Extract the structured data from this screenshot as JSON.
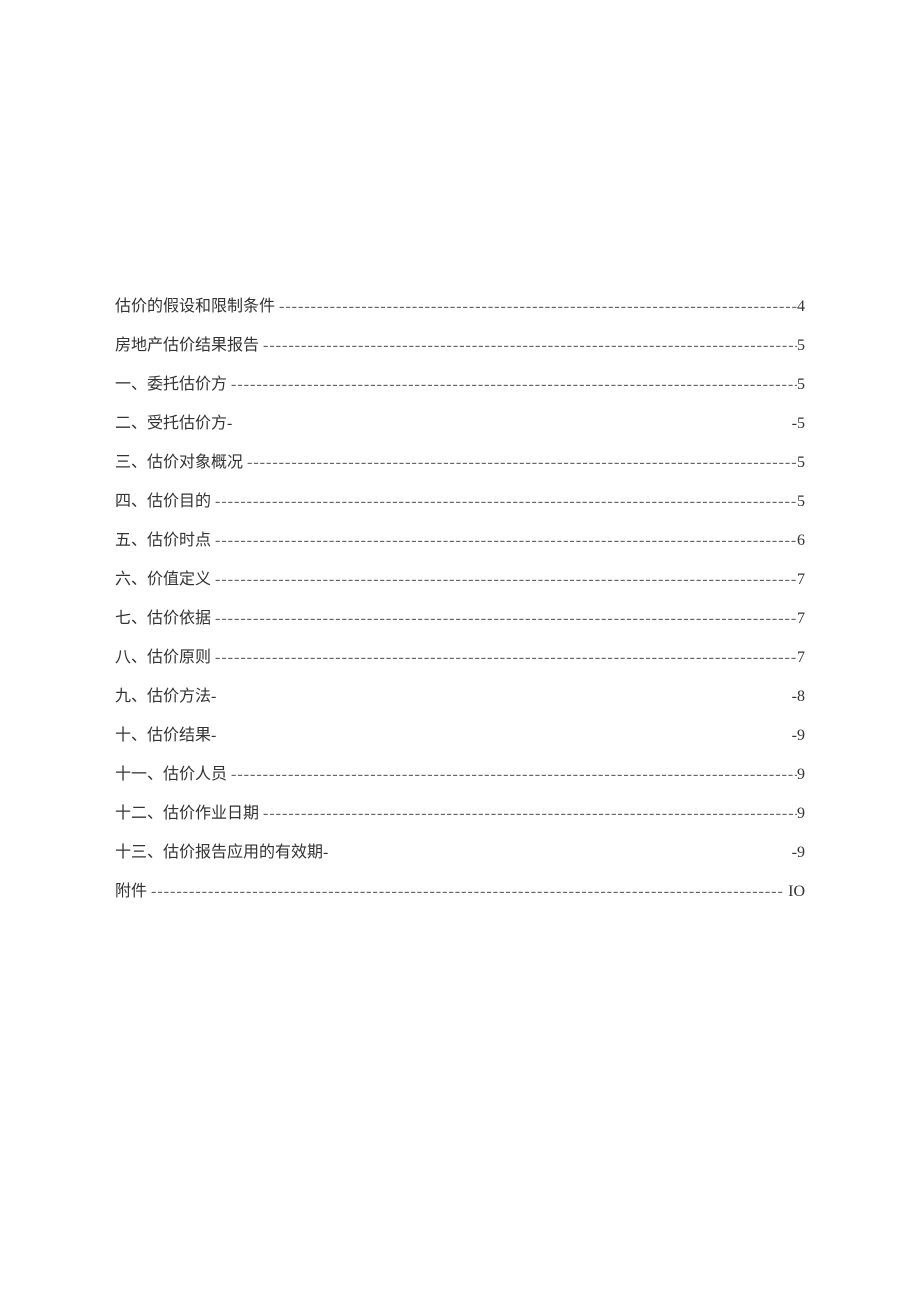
{
  "toc": {
    "entries": [
      {
        "title": "估价的假设和限制条件",
        "page": "4",
        "leader": "dashes",
        "pagePrefix": ""
      },
      {
        "title": "房地产估价结果报告",
        "page": "5",
        "leader": "dashes",
        "pagePrefix": ""
      },
      {
        "title": "一、委托估价方",
        "page": "5",
        "leader": "dashes",
        "pagePrefix": ""
      },
      {
        "title": "二、受托估价方-",
        "page": "5",
        "leader": "blank",
        "pagePrefix": "-"
      },
      {
        "title": "三、估价对象概况",
        "page": "5",
        "leader": "dashes",
        "pagePrefix": ""
      },
      {
        "title": "四、估价目的",
        "page": "5",
        "leader": "dashes",
        "pagePrefix": ""
      },
      {
        "title": "五、估价时点",
        "page": "6",
        "leader": "dashes",
        "pagePrefix": ""
      },
      {
        "title": "六、价值定义",
        "page": "7",
        "leader": "dashes",
        "pagePrefix": ""
      },
      {
        "title": "七、估价依据",
        "page": "7",
        "leader": "dashes",
        "pagePrefix": ""
      },
      {
        "title": "八、估价原则",
        "page": "7",
        "leader": "dashes",
        "pagePrefix": ""
      },
      {
        "title": "九、估价方法-",
        "page": "8",
        "leader": "blank",
        "pagePrefix": "-"
      },
      {
        "title": "十、估价结果-",
        "page": "9",
        "leader": "blank",
        "pagePrefix": "-"
      },
      {
        "title": "十一、估价人员",
        "page": "9",
        "leader": "dashes",
        "pagePrefix": ""
      },
      {
        "title": "十二、估价作业日期",
        "page": "9",
        "leader": "dashes",
        "pagePrefix": ""
      },
      {
        "title": "十三、估价报告应用的有效期-",
        "page": "9",
        "leader": "blank",
        "pagePrefix": "-"
      },
      {
        "title": "附件",
        "page": "IO",
        "leader": "dashes",
        "pagePrefix": ""
      }
    ]
  }
}
